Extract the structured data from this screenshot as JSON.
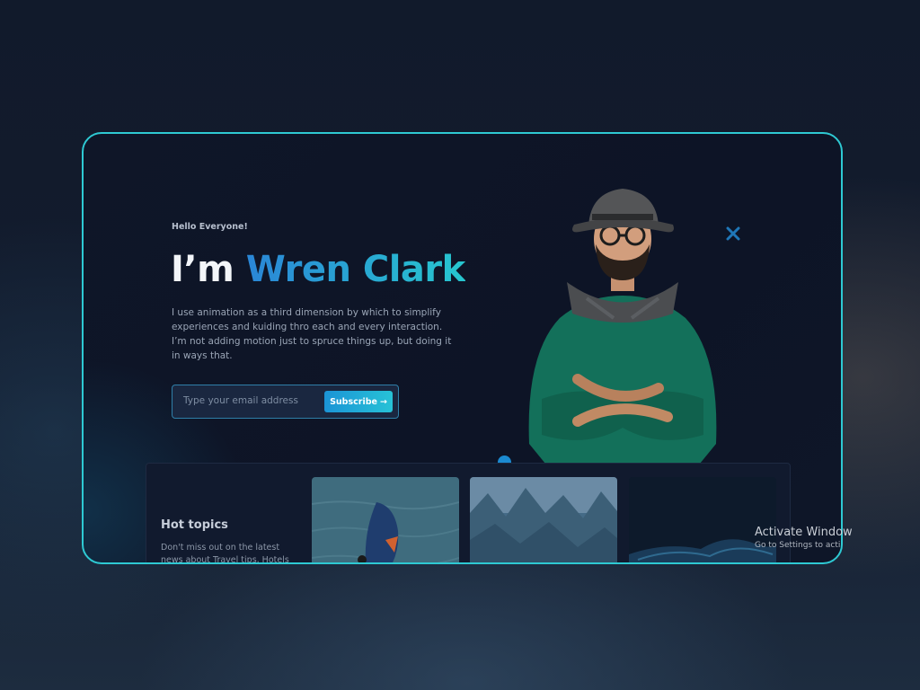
{
  "hero": {
    "greeting": "Hello Everyone!",
    "title_prefix": "I’m ",
    "title_name": "Wren Clark",
    "description": "I use animation as a third dimension by which to simplify experiences and kuiding thro each and every interaction. I’m not adding motion just to spruce things up, but doing it in ways that."
  },
  "subscribe": {
    "email_placeholder": "Type your email address",
    "button_label": "Subscribe",
    "button_icon": "arrow-right-icon"
  },
  "icons": {
    "close": "close-icon"
  },
  "hot_topics": {
    "title": "Hot topics",
    "description": "Don't miss out on the latest news about Travel tips, Hotels review,"
  },
  "topic_cards": [
    {
      "image": "windsurf-photo"
    },
    {
      "image": "foggy-forest-photo"
    },
    {
      "image": "dark-wave-photo"
    }
  ],
  "watermark": {
    "title": "Activate Window",
    "subtitle": "Go to Settings to acti"
  },
  "colors": {
    "accent": "#2ec9d3",
    "name_gradient_start": "#2a86d6",
    "name_gradient_end": "#27c6cf",
    "background": "#0f1628"
  }
}
